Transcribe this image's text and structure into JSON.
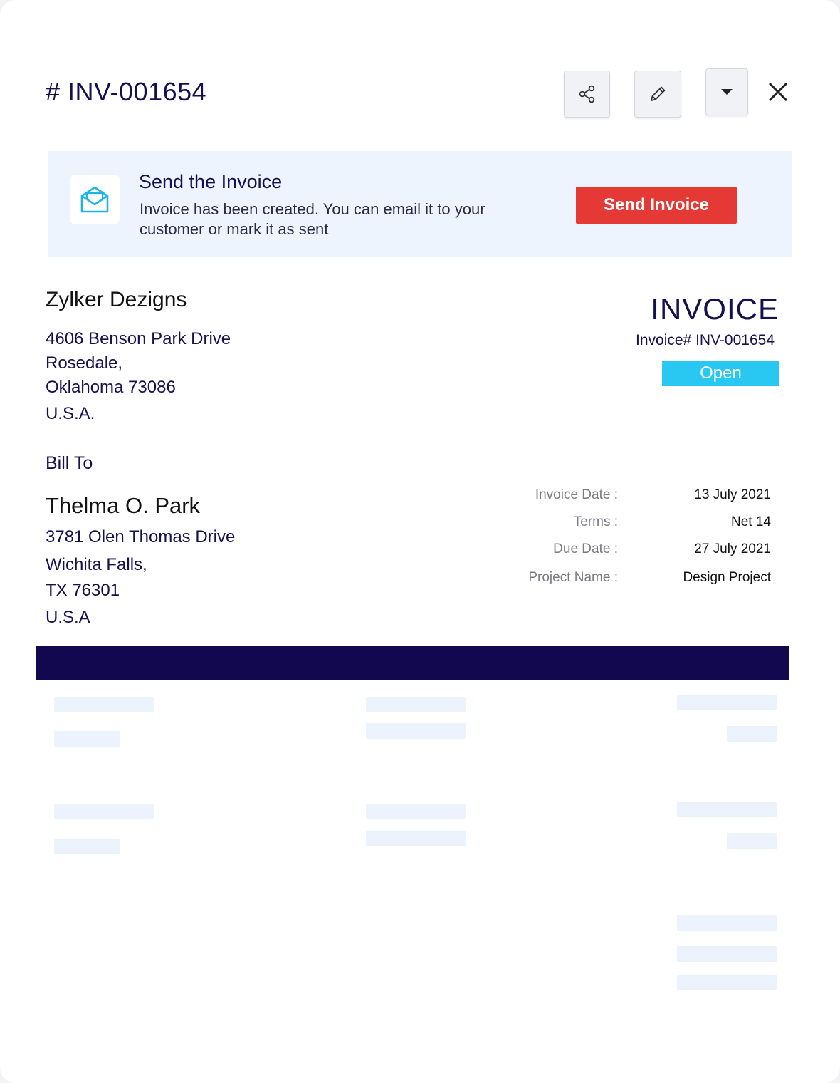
{
  "header": {
    "title": "# INV-001654",
    "share_icon": "share-icon",
    "edit_icon": "pencil-icon",
    "more_icon": "caret-down-icon",
    "close_icon": "close-icon"
  },
  "banner": {
    "icon": "open-envelope-icon",
    "title": "Send the Invoice",
    "text_line1": "Invoice has been created. You can email it to your",
    "text_line2": "customer or mark it as sent",
    "button_label": "Send Invoice",
    "button_color": "#e53935",
    "background": "#eef4fd"
  },
  "company": {
    "name": "Zylker Dezigns",
    "address": [
      "4606 Benson Park Drive",
      "Rosedale,",
      "Oklahoma 73086",
      "U.S.A."
    ]
  },
  "invoice": {
    "label": "INVOICE",
    "number_text": "Invoice# INV-001654",
    "status": "Open",
    "status_color": "#29c8f2"
  },
  "bill_to": {
    "label": "Bill To",
    "name": "Thelma O. Park",
    "address": [
      "3781 Olen Thomas Drive",
      "Wichita Falls,",
      "TX 76301",
      "U.S.A"
    ]
  },
  "details": [
    {
      "label": "Invoice Date :",
      "value": "13  July 2021"
    },
    {
      "label": "Terms :",
      "value": "Net 14"
    },
    {
      "label": "Due Date :",
      "value": "27 July 2021"
    },
    {
      "label": "Project Name :",
      "value": "Design Project"
    }
  ],
  "colors": {
    "navy": "#15104f",
    "table_header": "#120850",
    "placeholder": "#edf3fd"
  }
}
